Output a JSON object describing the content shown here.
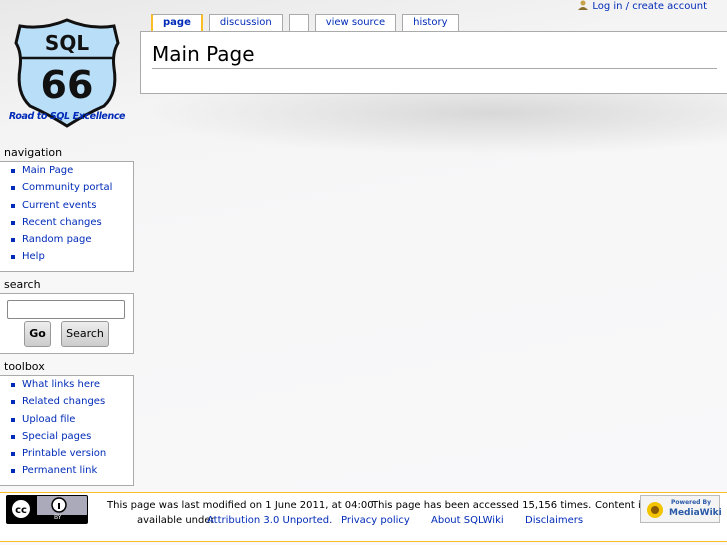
{
  "personal": {
    "login": "Log in / create account"
  },
  "logo": {
    "top": "SQL",
    "number": "66",
    "tagline": "Road to SQL Excellence"
  },
  "tabs": [
    {
      "label": "page"
    },
    {
      "label": "discussion"
    },
    {
      "label": ""
    },
    {
      "label": "view source"
    },
    {
      "label": "history"
    }
  ],
  "page": {
    "title": "Main Page"
  },
  "navigation": {
    "heading": "navigation",
    "items": [
      "Main Page",
      "Community portal",
      "Current events",
      "Recent changes",
      "Random page",
      "Help"
    ]
  },
  "search": {
    "heading": "search",
    "value": "",
    "go": "Go",
    "search": "Search"
  },
  "toolbox": {
    "heading": "toolbox",
    "items": [
      "What links here",
      "Related changes",
      "Upload file",
      "Special pages",
      "Printable version",
      "Permanent link"
    ]
  },
  "footer": {
    "modified": "This page was last modified on 1 June 2011, at 04:00.",
    "accessed": "This page has been accessed 15,156 times.",
    "content_is": "Content is",
    "available_under": "available under",
    "license": "Attribution 3.0 Unported.",
    "privacy": "Privacy policy",
    "about": "About SQLWiki",
    "disclaimers": "Disclaimers",
    "cc_by": "BY",
    "powered_by": "Powered By",
    "mediawiki": "MediaWiki"
  }
}
